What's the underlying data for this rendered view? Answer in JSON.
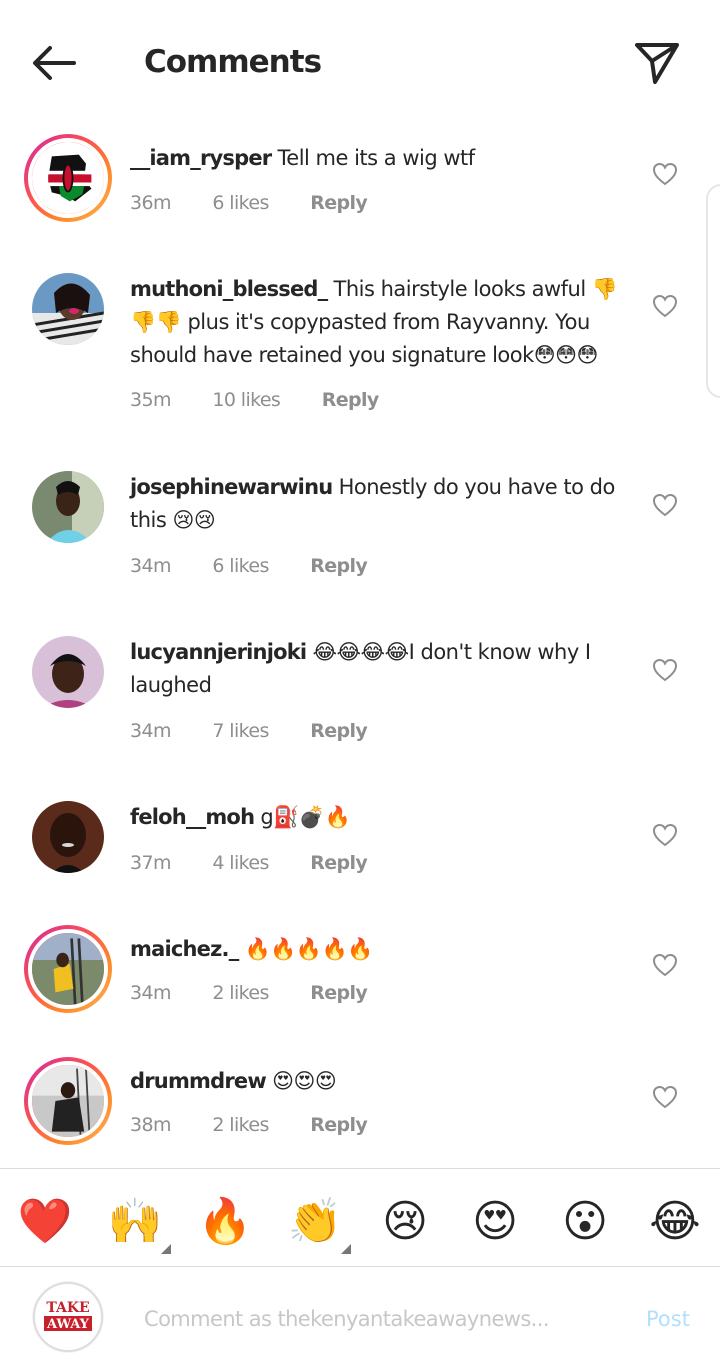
{
  "header": {
    "title": "Comments",
    "back_icon": "arrow-left-icon",
    "share_icon": "paper-plane-icon"
  },
  "comments": [
    {
      "username": "__iam_rysper",
      "text": "Tell me its a wig wtf",
      "time": "36m",
      "likes": "6 likes",
      "reply": "Reply"
    },
    {
      "username": "muthoni_blessed_",
      "text": "This hairstyle looks awful 👎👎👎 plus it's copypasted from Rayvanny.  You should have retained you signature look😳😳😳",
      "time": "35m",
      "likes": "10 likes",
      "reply": "Reply"
    },
    {
      "username": "josephinewarwinu",
      "text": "Honestly  do you  have to do this 😢😢",
      "time": "34m",
      "likes": "6 likes",
      "reply": "Reply"
    },
    {
      "username": "lucyannjerinjoki",
      "text": "😂😂😂😂I don't know why I laughed",
      "time": "34m",
      "likes": "7 likes",
      "reply": "Reply"
    },
    {
      "username": "feloh__moh",
      "text": "g⛽💣🔥",
      "time": "37m",
      "likes": "4 likes",
      "reply": "Reply"
    },
    {
      "username": "maichez._",
      "text": "🔥🔥🔥🔥🔥",
      "time": "34m",
      "likes": "2 likes",
      "reply": "Reply"
    },
    {
      "username": "drummdrew",
      "text": "😍😍😍",
      "time": "38m",
      "likes": "2 likes",
      "reply": "Reply"
    }
  ],
  "emoji_bar": [
    "❤️",
    "🙌",
    "🔥",
    "👏",
    "😢",
    "😍",
    "😮",
    "😂"
  ],
  "compose": {
    "avatar_line1": "TAKE",
    "avatar_line2": "AWAY",
    "placeholder": "Comment as thekenyantakeawaynews...",
    "post_label": "Post"
  },
  "colors": {
    "text": "#262626",
    "meta": "#8e8e8e",
    "post_disabled": "#b2dffc",
    "story_ring": "#fd5949"
  }
}
